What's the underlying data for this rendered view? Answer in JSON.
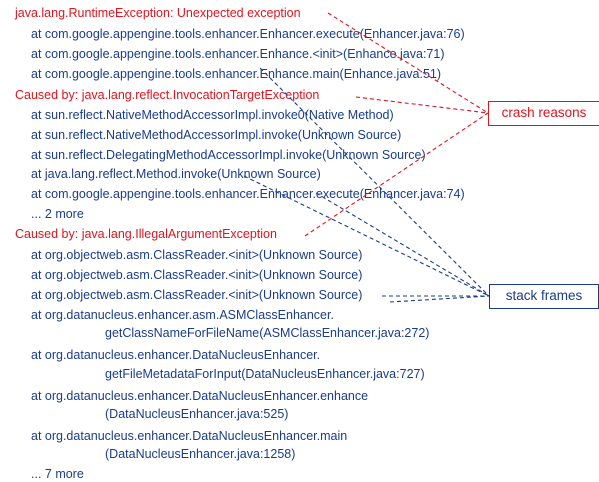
{
  "trace": {
    "header": "java.lang.RuntimeException: Unexpected exception",
    "f1": "at com.google.appengine.tools.enhancer.Enhancer.execute(Enhancer.java:76)",
    "f2": "at com.google.appengine.tools.enhancer.Enhance.<init>(Enhance.java:71)",
    "f3": "at com.google.appengine.tools.enhancer.Enhance.main(Enhance.java:51)",
    "cause1": "Caused by: java.lang.reflect.InvocationTargetException",
    "f4": "at sun.reflect.NativeMethodAccessorImpl.invoke0(Native Method)",
    "f5": "at sun.reflect.NativeMethodAccessorImpl.invoke(Unknown Source)",
    "f6": "at sun.reflect.DelegatingMethodAccessorImpl.invoke(Unknown Source)",
    "f7": "at java.lang.reflect.Method.invoke(Unknown Source)",
    "f8": "at com.google.appengine.tools.enhancer.Enhancer.execute(Enhancer.java:74)",
    "more1": "... 2 more",
    "cause2": "Caused by: java.lang.IllegalArgumentException",
    "f9": "at org.objectweb.asm.ClassReader.<init>(Unknown Source)",
    "f10": "at org.objectweb.asm.ClassReader.<init>(Unknown Source)",
    "f11": "at org.objectweb.asm.ClassReader.<init>(Unknown Source)",
    "f12a": "at org.datanucleus.enhancer.asm.ASMClassEnhancer.",
    "f12b": "getClassNameForFileName(ASMClassEnhancer.java:272)",
    "f13a": "at org.datanucleus.enhancer.DataNucleusEnhancer.",
    "f13b": "getFileMetadataForInput(DataNucleusEnhancer.java:727)",
    "f14a": "at org.datanucleus.enhancer.DataNucleusEnhancer.enhance",
    "f14b": "(DataNucleusEnhancer.java:525)",
    "f15a": "at org.datanucleus.enhancer.DataNucleusEnhancer.main",
    "f15b": "(DataNucleusEnhancer.java:1258)",
    "more2": "... 7 more"
  },
  "annotations": {
    "crash_reasons": "crash reasons",
    "stack_frames": "stack frames"
  },
  "colors": {
    "exception_red": "#e0141e",
    "frame_blue": "#1a3c8c"
  }
}
